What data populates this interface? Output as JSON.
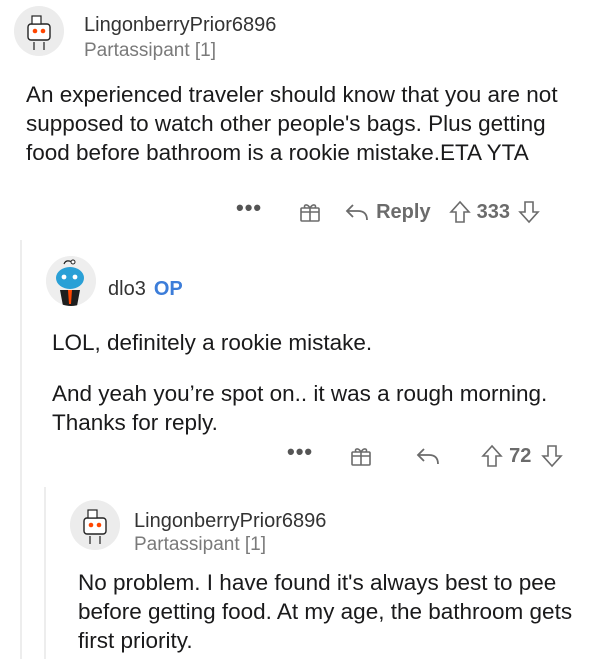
{
  "comments": [
    {
      "author": "LingonberryPrior6896",
      "flair": "Partassipant [1]",
      "body": [
        "An experienced traveler should know that you are not supposed to watch other people's bags. Plus getting food before bathroom is a rookie mistake.ETA YTA"
      ],
      "actions": {
        "more": "•••",
        "reply": "Reply",
        "score": "333"
      }
    },
    {
      "author": "dlo3",
      "badge": "OP",
      "body": [
        "LOL, definitely a rookie mistake.",
        "And yeah you’re spot on.. it was a rough morning. Thanks for reply."
      ],
      "actions": {
        "more": "•••",
        "score": "72"
      }
    },
    {
      "author": "LingonberryPrior6896",
      "flair": "Partassipant [1]",
      "body": [
        "No problem. I have found it's always best to pee before getting food. At my age, the bathroom gets first priority."
      ]
    }
  ],
  "icons": {
    "avatar1": "snoo-avatar-icon",
    "avatar2": "snoo-avatar-icon",
    "avatar3": "snoo-avatar-icon",
    "award": "gift-icon",
    "reply": "reply-arrow-icon",
    "upvote": "upvote-arrow-icon",
    "downvote": "downvote-arrow-icon"
  },
  "colors": {
    "op_badge": "#3c7dd9",
    "meta": "#7a7a7a",
    "text": "#1a1a1b"
  }
}
